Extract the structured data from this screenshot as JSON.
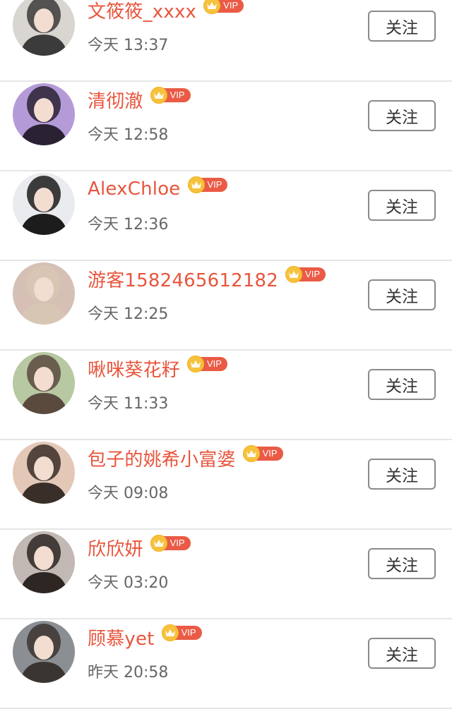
{
  "follow_label": "关注",
  "vip_label": "VIP",
  "colors": {
    "name": "#e8553d",
    "vip_tag": "#ea5a45",
    "crown": "#f6c23d"
  },
  "users": [
    {
      "name": "文筱筱_xxxx",
      "time": "今天 13:37",
      "avatar_hue": "#3b3b3b",
      "avatar_bg": "#d9d6d2",
      "avatar": "person-dark-outfit"
    },
    {
      "name": "清彻澈",
      "time": "今天 12:58",
      "avatar_hue": "#2a2233",
      "avatar_bg": "#b49bd8",
      "avatar": "person-purple-bg"
    },
    {
      "name": "AlexChloe",
      "time": "今天 12:36",
      "avatar_hue": "#1c1c1c",
      "avatar_bg": "#e9ebee",
      "avatar": "person-suit"
    },
    {
      "name": "游客1582465612182",
      "time": "今天 12:25",
      "avatar_hue": "#d8c6b4",
      "avatar_bg": "#d6c0b6",
      "avatar": "person-blonde"
    },
    {
      "name": "啾咪葵花籽",
      "time": "今天 11:33",
      "avatar_hue": "#5a4a3e",
      "avatar_bg": "#b8c8a2",
      "avatar": "person-flower-crown"
    },
    {
      "name": "包子的姚希小富婆",
      "time": "今天 09:08",
      "avatar_hue": "#3a2e28",
      "avatar_bg": "#e3c8b8",
      "avatar": "person-selfie"
    },
    {
      "name": "欣欣妍",
      "time": "今天 03:20",
      "avatar_hue": "#2e2622",
      "avatar_bg": "#c2b8b4",
      "avatar": "person-peace-sign"
    },
    {
      "name": "顾慕yet",
      "time": "昨天 20:58",
      "avatar_hue": "#3b3531",
      "avatar_bg": "#8b8f94",
      "avatar": "person-dark-room"
    }
  ]
}
